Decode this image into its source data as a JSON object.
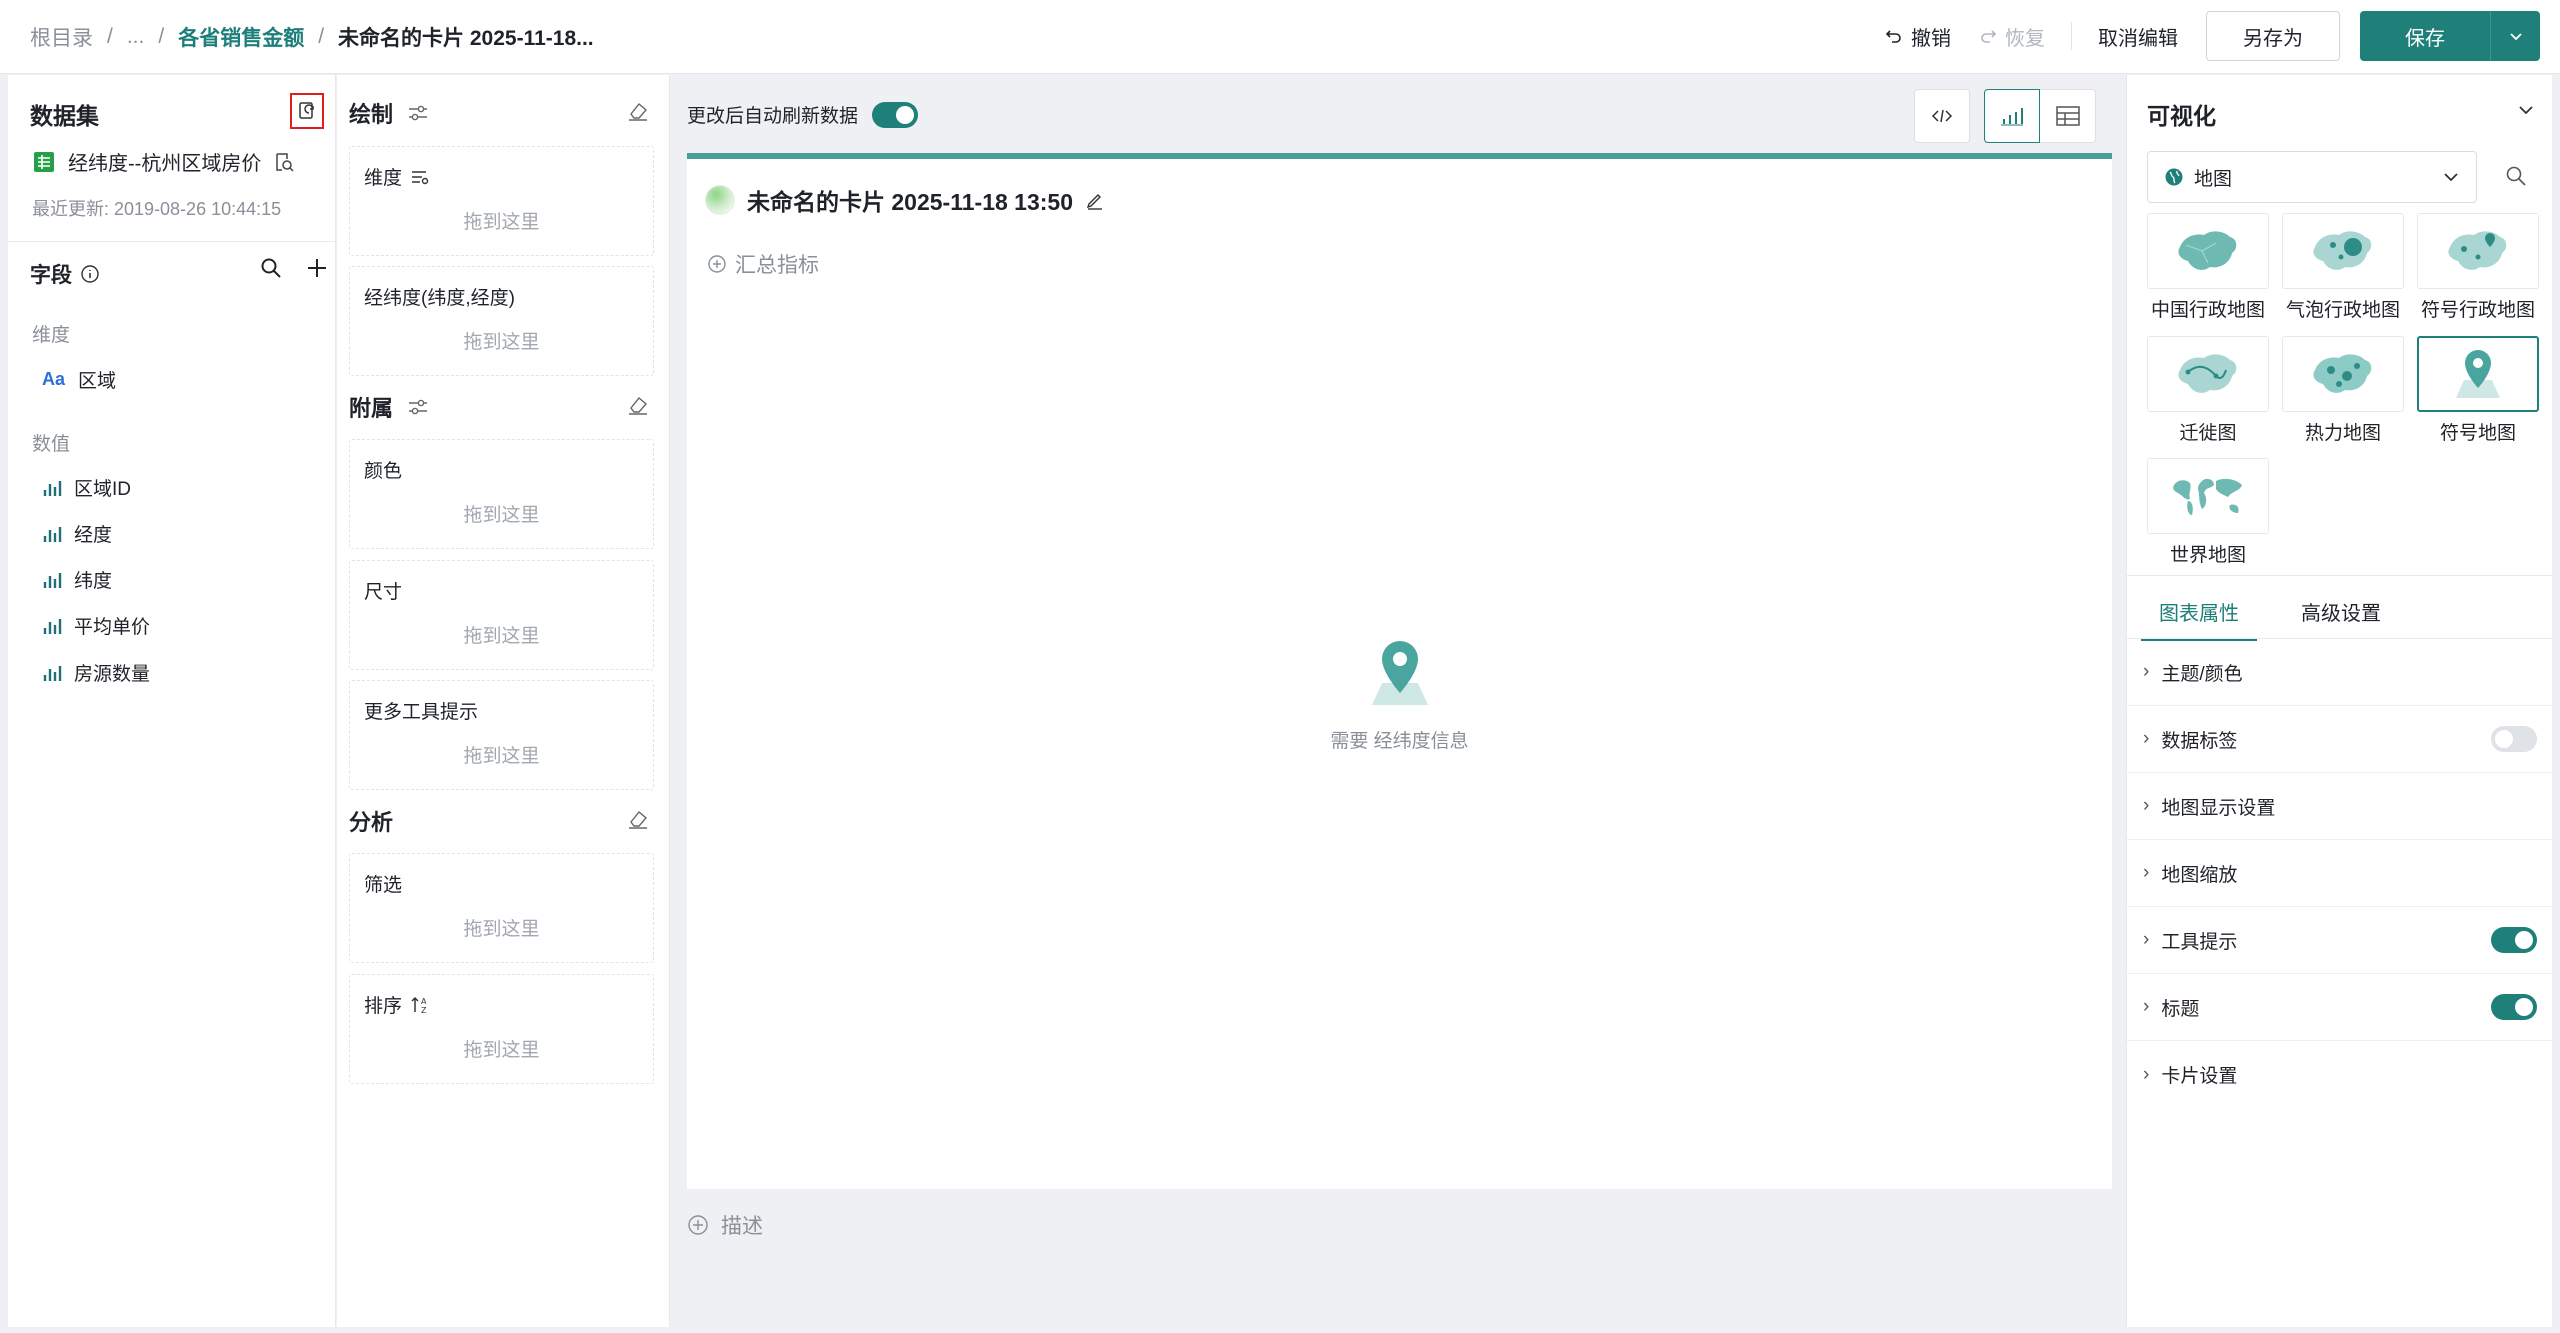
{
  "breadcrumb": {
    "root": "根目录",
    "ellipsis": "...",
    "parent": "各省销售金额",
    "current": "未命名的卡片 2025-11-18..."
  },
  "toolbar": {
    "undo": "撤销",
    "redo": "恢复",
    "cancel_edit": "取消编辑",
    "save_as": "另存为",
    "save": "保存"
  },
  "dataset": {
    "title": "数据集",
    "name": "经纬度--杭州区域房价",
    "updated": "最近更新: 2019-08-26 10:44:15"
  },
  "fields": {
    "title": "字段",
    "dimension_label": "维度",
    "dimensions": [
      {
        "name": "区域",
        "icon": "text-type-icon"
      }
    ],
    "measure_label": "数值",
    "measures": [
      {
        "name": "区域ID",
        "icon": "bar-measure-icon"
      },
      {
        "name": "经度",
        "icon": "bar-measure-icon"
      },
      {
        "name": "纬度",
        "icon": "bar-measure-icon"
      },
      {
        "name": "平均单价",
        "icon": "bar-measure-icon"
      },
      {
        "name": "房源数量",
        "icon": "bar-measure-icon"
      }
    ]
  },
  "config": {
    "draw_title": "绘制",
    "attach_title": "附属",
    "analysis_title": "分析",
    "drop_hint": "拖到这里",
    "slots": {
      "dimension": "维度",
      "latlng": "经纬度(纬度,经度)",
      "color": "颜色",
      "size": "尺寸",
      "tooltip": "更多工具提示",
      "filter": "筛选",
      "sort": "排序"
    }
  },
  "canvas": {
    "auto_refresh": "更改后自动刷新数据",
    "auto_refresh_on": true,
    "card_title": "未命名的卡片 2025-11-18 13:50",
    "metric": "汇总指标",
    "empty_text": "需要 经纬度信息",
    "describe": "描述"
  },
  "viz": {
    "title": "可视化",
    "selected_type": "地图",
    "tiles": [
      {
        "label": "中国行政地图",
        "icon": "china-map-icon"
      },
      {
        "label": "气泡行政地图",
        "icon": "bubble-map-icon"
      },
      {
        "label": "符号行政地图",
        "icon": "symbol-admin-map-icon"
      },
      {
        "label": "迁徙图",
        "icon": "migration-map-icon"
      },
      {
        "label": "热力地图",
        "icon": "heat-map-icon"
      },
      {
        "label": "符号地图",
        "icon": "symbol-map-icon",
        "active": true
      },
      {
        "label": "世界地图",
        "icon": "world-map-icon"
      }
    ],
    "tabs": [
      "图表属性",
      "高级设置"
    ],
    "properties": [
      {
        "label": "主题/颜色"
      },
      {
        "label": "数据标签",
        "toggle": false
      },
      {
        "label": "地图显示设置"
      },
      {
        "label": "地图缩放"
      },
      {
        "label": "工具提示",
        "toggle": true
      },
      {
        "label": "标题",
        "toggle": true
      },
      {
        "label": "卡片设置"
      }
    ]
  },
  "colors": {
    "accent": "#1f7f79",
    "card_border": "#4a9f9a",
    "map_teal": "#5fb3ad"
  }
}
